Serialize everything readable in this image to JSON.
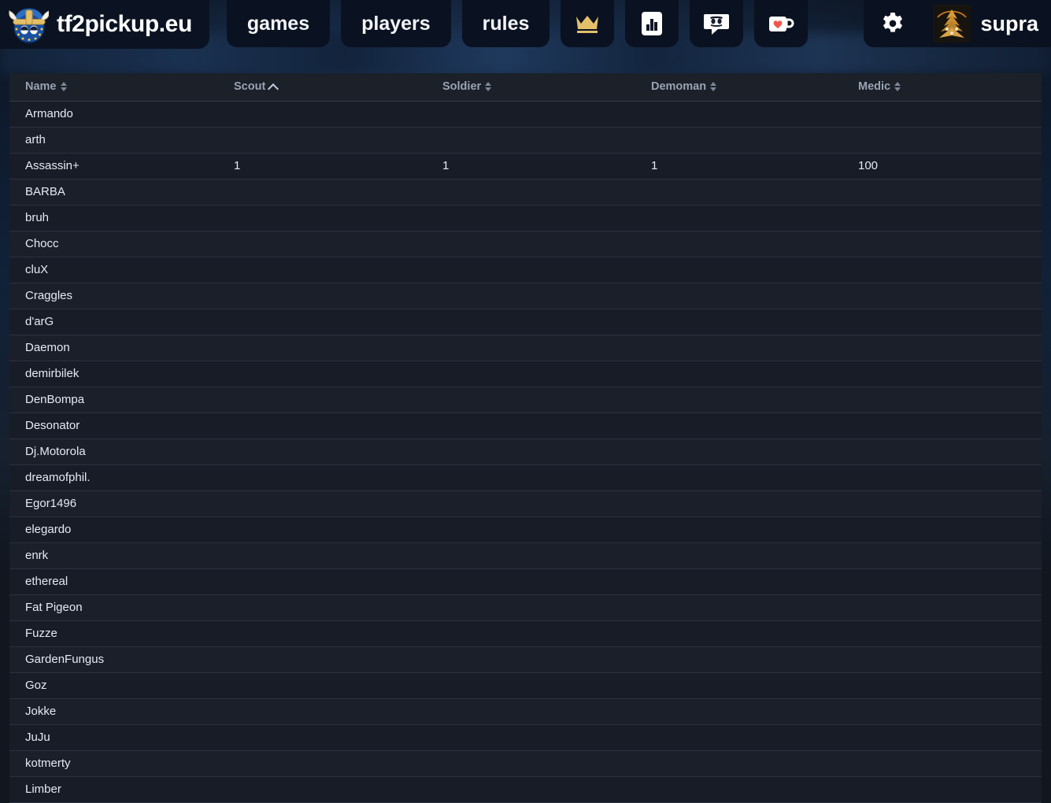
{
  "brand": {
    "name": "tf2pickup.eu",
    "logo_icon": "viking-eu-logo-icon"
  },
  "nav": {
    "links": [
      {
        "label": "games"
      },
      {
        "label": "players"
      },
      {
        "label": "rules"
      }
    ],
    "icons": [
      {
        "name": "crown-icon",
        "color": "#e3c069"
      },
      {
        "name": "statistics-icon",
        "color": "#ffffff"
      },
      {
        "name": "discord-icon",
        "color": "#ffffff"
      },
      {
        "name": "kofi-heart-cup-icon",
        "color": "#ffffff",
        "accent": "#f2564f"
      }
    ],
    "settings": {
      "name": "gear-icon",
      "color": "#ffffff"
    },
    "user": {
      "name": "supra",
      "avatar_icon": "user-avatar"
    }
  },
  "table": {
    "columns": [
      {
        "key": "name",
        "label": "Name",
        "sort": "both"
      },
      {
        "key": "scout",
        "label": "Scout",
        "sort": "asc"
      },
      {
        "key": "soldier",
        "label": "Soldier",
        "sort": "both"
      },
      {
        "key": "demoman",
        "label": "Demoman",
        "sort": "both"
      },
      {
        "key": "medic",
        "label": "Medic",
        "sort": "both"
      }
    ],
    "rows": [
      {
        "name": "Armando",
        "scout": "",
        "soldier": "",
        "demoman": "",
        "medic": ""
      },
      {
        "name": "arth",
        "scout": "",
        "soldier": "",
        "demoman": "",
        "medic": ""
      },
      {
        "name": "Assassin+",
        "scout": "1",
        "soldier": "1",
        "demoman": "1",
        "medic": "100"
      },
      {
        "name": "BARBA",
        "scout": "",
        "soldier": "",
        "demoman": "",
        "medic": ""
      },
      {
        "name": "bruh",
        "scout": "",
        "soldier": "",
        "demoman": "",
        "medic": ""
      },
      {
        "name": "Chocc",
        "scout": "",
        "soldier": "",
        "demoman": "",
        "medic": ""
      },
      {
        "name": "cluX",
        "scout": "",
        "soldier": "",
        "demoman": "",
        "medic": ""
      },
      {
        "name": "Craggles",
        "scout": "",
        "soldier": "",
        "demoman": "",
        "medic": ""
      },
      {
        "name": "d'arG",
        "scout": "",
        "soldier": "",
        "demoman": "",
        "medic": ""
      },
      {
        "name": "Daemon",
        "scout": "",
        "soldier": "",
        "demoman": "",
        "medic": ""
      },
      {
        "name": "demirbilek",
        "scout": "",
        "soldier": "",
        "demoman": "",
        "medic": ""
      },
      {
        "name": "DenBompa",
        "scout": "",
        "soldier": "",
        "demoman": "",
        "medic": ""
      },
      {
        "name": "Desonator",
        "scout": "",
        "soldier": "",
        "demoman": "",
        "medic": ""
      },
      {
        "name": "Dj.Motorola",
        "scout": "",
        "soldier": "",
        "demoman": "",
        "medic": ""
      },
      {
        "name": "dreamofphil.",
        "scout": "",
        "soldier": "",
        "demoman": "",
        "medic": ""
      },
      {
        "name": "Egor1496",
        "scout": "",
        "soldier": "",
        "demoman": "",
        "medic": ""
      },
      {
        "name": "elegardo",
        "scout": "",
        "soldier": "",
        "demoman": "",
        "medic": ""
      },
      {
        "name": "enrk",
        "scout": "",
        "soldier": "",
        "demoman": "",
        "medic": ""
      },
      {
        "name": "ethereal",
        "scout": "",
        "soldier": "",
        "demoman": "",
        "medic": ""
      },
      {
        "name": "Fat Pigeon",
        "scout": "",
        "soldier": "",
        "demoman": "",
        "medic": ""
      },
      {
        "name": "Fuzze",
        "scout": "",
        "soldier": "",
        "demoman": "",
        "medic": ""
      },
      {
        "name": "GardenFungus",
        "scout": "",
        "soldier": "",
        "demoman": "",
        "medic": ""
      },
      {
        "name": "Goz",
        "scout": "",
        "soldier": "",
        "demoman": "",
        "medic": ""
      },
      {
        "name": "Jokke",
        "scout": "",
        "soldier": "",
        "demoman": "",
        "medic": ""
      },
      {
        "name": "JuJu",
        "scout": "",
        "soldier": "",
        "demoman": "",
        "medic": ""
      },
      {
        "name": "kotmerty",
        "scout": "",
        "soldier": "",
        "demoman": "",
        "medic": ""
      },
      {
        "name": "Limber",
        "scout": "",
        "soldier": "",
        "demoman": "",
        "medic": ""
      }
    ]
  },
  "colors": {
    "page_bg": "#11161f",
    "navbar_tab": "#0a1120",
    "table_header_bg": "#1b2029",
    "row_bg_a": "#171c26",
    "row_bg_b": "#1a1f29",
    "gold": "#e3c069",
    "heart_red": "#f2564f"
  }
}
